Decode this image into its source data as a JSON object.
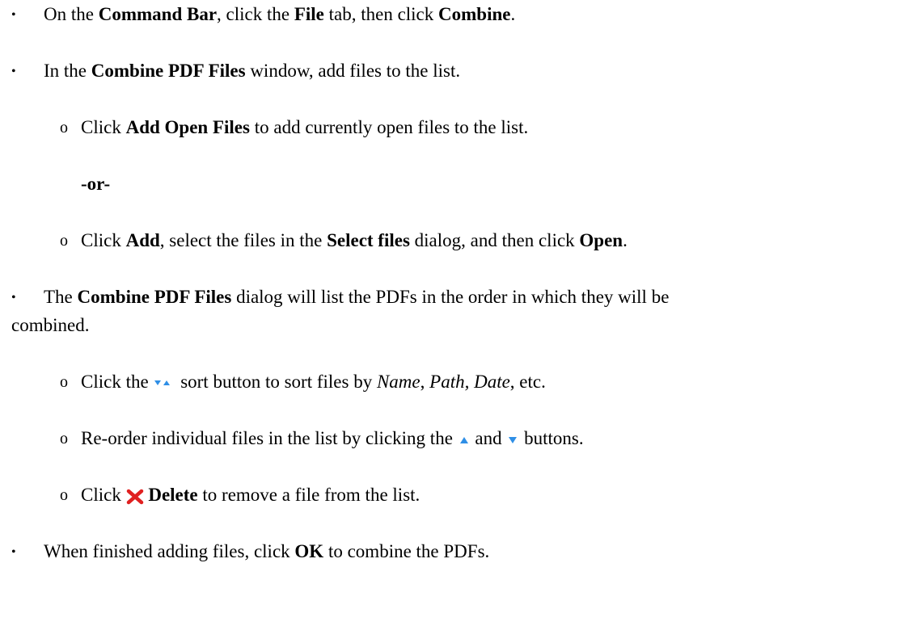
{
  "bullet_glyph": "•",
  "sub_bullet_glyph": "o",
  "lines": {
    "l1": {
      "a": "On the ",
      "b": "Command Bar",
      "c": ", click the ",
      "d": "File",
      "e": " tab, then click ",
      "f": "Combine",
      "g": "."
    },
    "l2": {
      "a": "In the ",
      "b": "Combine PDF Files",
      "c": " window, add files to the list."
    },
    "l3": {
      "a": "Click ",
      "b": "Add Open Files",
      "c": " to add currently open files to the list."
    },
    "l4": {
      "a": "-or-"
    },
    "l5": {
      "a": "Click ",
      "b": "Add",
      "c": ", select the files in the ",
      "d": "Select files",
      "e": " dialog, and then click ",
      "f": "Open",
      "g": "."
    },
    "l6": {
      "a": "The ",
      "b": "Combine PDF Files",
      "c": " dialog will list the PDFs in the order in which they will be"
    },
    "l7": {
      "a": "combined."
    },
    "l8": {
      "a": "Click the ",
      "b": " sort button to sort files by ",
      "c": "Name",
      "d": ", ",
      "e": "Path, Date",
      "f": ", etc."
    },
    "l9": {
      "a": "Re-order individual files in the list by clicking the ",
      "b": " and ",
      "c": " buttons."
    },
    "l10": {
      "a": "Click ",
      "b": "Delete",
      "c": " to remove a file from the list."
    },
    "l11": {
      "a": "When finished adding files, click ",
      "b": "OK",
      "c": " to combine the PDFs."
    }
  },
  "icons": {
    "sort": "sort-icon",
    "up": "up-arrow-icon",
    "down": "down-arrow-icon",
    "delete": "delete-x-icon"
  },
  "colors": {
    "arrow_blue": "#2f8fe6",
    "delete_red": "#e02020"
  }
}
